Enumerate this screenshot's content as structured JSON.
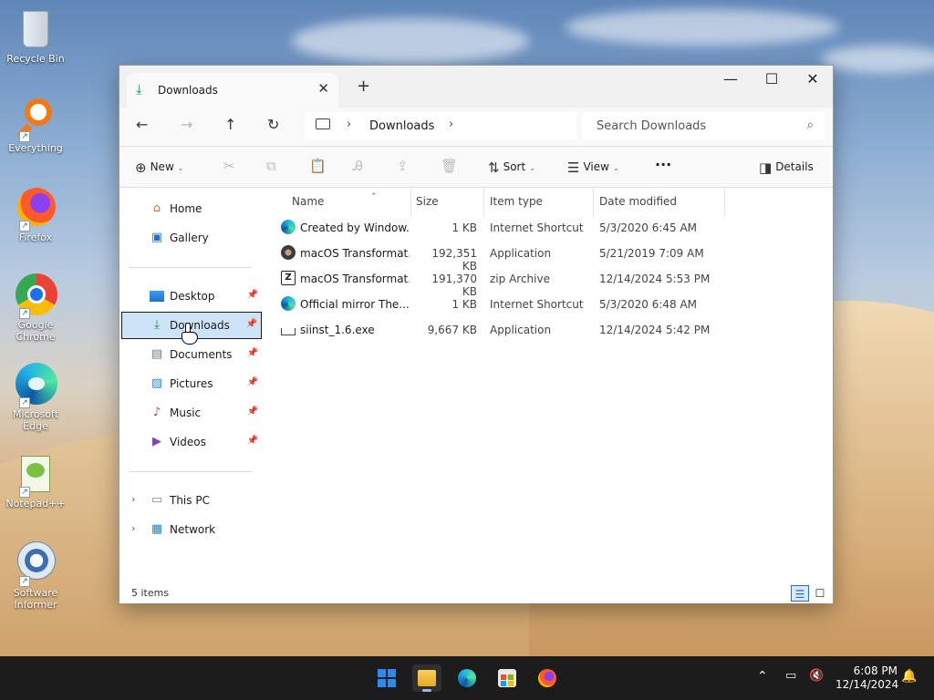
{
  "desktop": {
    "icons": [
      {
        "label": "Recycle Bin"
      },
      {
        "label": "Everything"
      },
      {
        "label": "Firefox"
      },
      {
        "label": "Google Chrome"
      },
      {
        "label": "Microsoft Edge"
      },
      {
        "label": "Notepad++"
      },
      {
        "label": "Software Informer"
      }
    ]
  },
  "window": {
    "tab_title": "Downloads",
    "tab_close_glyph": "✕",
    "new_tab_glyph": "+",
    "minimize_glyph": "—",
    "maximize_glyph": "☐",
    "close_glyph": "✕"
  },
  "address": {
    "back_glyph": "←",
    "forward_glyph": "→",
    "up_glyph": "↑",
    "refresh_glyph": "↻",
    "separator": "›",
    "path": "Downloads",
    "search_placeholder": "Search Downloads",
    "search_glyph": "⌕"
  },
  "toolbar": {
    "new_label": "New",
    "sort_label": "Sort",
    "view_label": "View",
    "more_glyph": "···",
    "details_label": "Details",
    "caret": "⌄",
    "cut_glyph": "✂",
    "copy_glyph": "⧉",
    "paste_glyph": "📋",
    "rename_glyph": "Ꭿ",
    "share_glyph": "⇪",
    "delete_glyph": "🗑"
  },
  "nav": {
    "home": "Home",
    "gallery": "Gallery",
    "quick": [
      {
        "label": "Desktop"
      },
      {
        "label": "Downloads"
      },
      {
        "label": "Documents"
      },
      {
        "label": "Pictures"
      },
      {
        "label": "Music"
      },
      {
        "label": "Videos"
      }
    ],
    "this_pc": "This PC",
    "network": "Network",
    "pin_glyph": "📌",
    "expand_glyph": "›"
  },
  "columns": {
    "name": "Name",
    "size": "Size",
    "type": "Item type",
    "date": "Date modified",
    "sort_glyph": "⌃"
  },
  "files": [
    {
      "name": "Created by Window...",
      "size": "1 KB",
      "type": "Internet Shortcut",
      "date": "5/3/2020 6:45 AM"
    },
    {
      "name": "macOS Transformat...",
      "size": "192,351 KB",
      "type": "Application",
      "date": "5/21/2019 7:09 AM"
    },
    {
      "name": "macOS Transformat...",
      "size": "191,370 KB",
      "type": "zip Archive",
      "date": "12/14/2024 5:53 PM"
    },
    {
      "name": "Official mirror The...",
      "size": "1 KB",
      "type": "Internet Shortcut",
      "date": "5/3/2020 6:48 AM"
    },
    {
      "name": "siinst_1.6.exe",
      "size": "9,667 KB",
      "type": "Application",
      "date": "12/14/2024 5:42 PM"
    }
  ],
  "status": {
    "items_text": "5 items"
  },
  "taskbar": {
    "tray_up_glyph": "⌃",
    "time": "6:08 PM",
    "date": "12/14/2024"
  }
}
